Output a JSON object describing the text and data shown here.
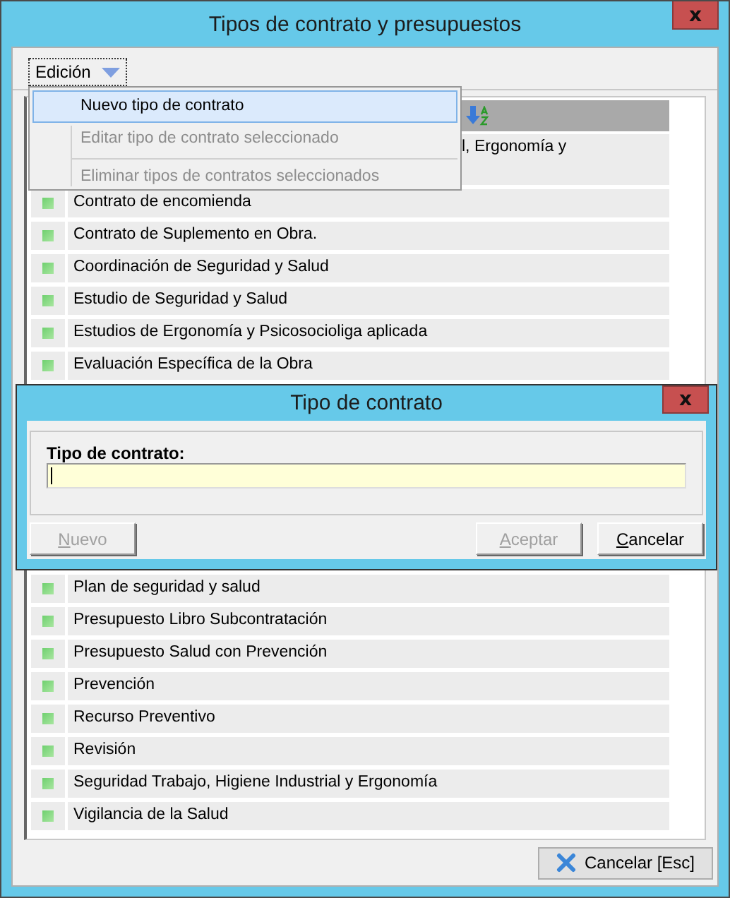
{
  "window": {
    "title": "Tipos de contrato y presupuestos",
    "close": "x"
  },
  "toolbar": {
    "menu_button": "Edición"
  },
  "menu": {
    "items": [
      {
        "kind": "item",
        "label": "Nuevo tipo de contrato",
        "selected": true,
        "disabled": false
      },
      {
        "kind": "item",
        "label": "Editar tipo de contrato seleccionado",
        "selected": false,
        "disabled": true
      },
      {
        "kind": "separator"
      },
      {
        "kind": "item",
        "label": "Eliminar tipos de contratos seleccionados",
        "selected": false,
        "disabled": true
      }
    ]
  },
  "list": {
    "cut_row": {
      "text": "l, Ergonomía y"
    },
    "rows_top": [
      {
        "text": "Contrato de encomienda"
      },
      {
        "text": "Contrato de Suplemento en Obra."
      },
      {
        "text": "Coordinación de Seguridad y Salud"
      },
      {
        "text": "Estudio de Seguridad y Salud"
      },
      {
        "text": "Estudios de Ergonomía y Psicosocioliga aplicada"
      },
      {
        "text": "Evaluación Específica de la Obra"
      }
    ],
    "rows_bottom": [
      {
        "text": "Plan de seguridad y salud"
      },
      {
        "text": "Presupuesto Libro Subcontratación"
      },
      {
        "text": "Presupuesto Salud con Prevención"
      },
      {
        "text": "Prevención"
      },
      {
        "text": "Recurso Preventivo"
      },
      {
        "text": "Revisión"
      },
      {
        "text": "Seguridad Trabajo, Higiene Industrial y Ergonomía"
      },
      {
        "text": "Vigilancia de la Salud"
      }
    ]
  },
  "footer": {
    "cancel_button": "Cancelar [Esc]"
  },
  "dialog": {
    "title": "Tipo de contrato",
    "close": "x",
    "field_label": "Tipo de contrato:",
    "focused": true,
    "buttons": [
      {
        "label": "Nuevo",
        "disabled": true
      },
      {
        "label": "Aceptar",
        "disabled": true
      },
      {
        "label": "Cancelar",
        "disabled": false
      }
    ]
  }
}
